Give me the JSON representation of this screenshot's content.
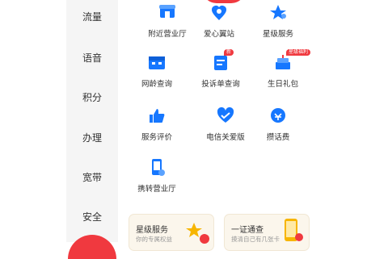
{
  "sidebar": {
    "items": [
      {
        "label": "流量"
      },
      {
        "label": "语音"
      },
      {
        "label": "积分"
      },
      {
        "label": "办理"
      },
      {
        "label": "宽带"
      },
      {
        "label": "安全"
      }
    ]
  },
  "services": {
    "row1": [
      {
        "label": "附近营业厅",
        "icon": "store-icon"
      },
      {
        "label": "爱心翼站",
        "icon": "heart-location-icon"
      },
      {
        "label": "星级服务",
        "icon": "star-service-icon"
      }
    ],
    "row2": [
      {
        "label": "网龄查询",
        "icon": "calendar-icon"
      },
      {
        "label": "投诉单查询",
        "icon": "complaint-doc-icon",
        "badge": "新"
      },
      {
        "label": "生日礼包",
        "icon": "birthday-cake-icon",
        "badge": "星级福利"
      }
    ],
    "row3": [
      {
        "label": "服务评价",
        "icon": "thumbs-up-icon"
      },
      {
        "label": "电信关爱版",
        "icon": "care-heart-icon"
      },
      {
        "label": "攒话费",
        "icon": "save-credit-icon"
      }
    ],
    "row4": [
      {
        "label": "携转营业厅",
        "icon": "transfer-phone-icon"
      }
    ]
  },
  "cards": [
    {
      "title": "星级服务",
      "subtitle": "你的专属权益"
    },
    {
      "title": "一证通查",
      "subtitle": "摸清自己有几张卡"
    }
  ],
  "colors": {
    "primary_blue": "#1677ff",
    "accent_red": "#f0393f",
    "rail_bg": "#f5f5f5"
  }
}
